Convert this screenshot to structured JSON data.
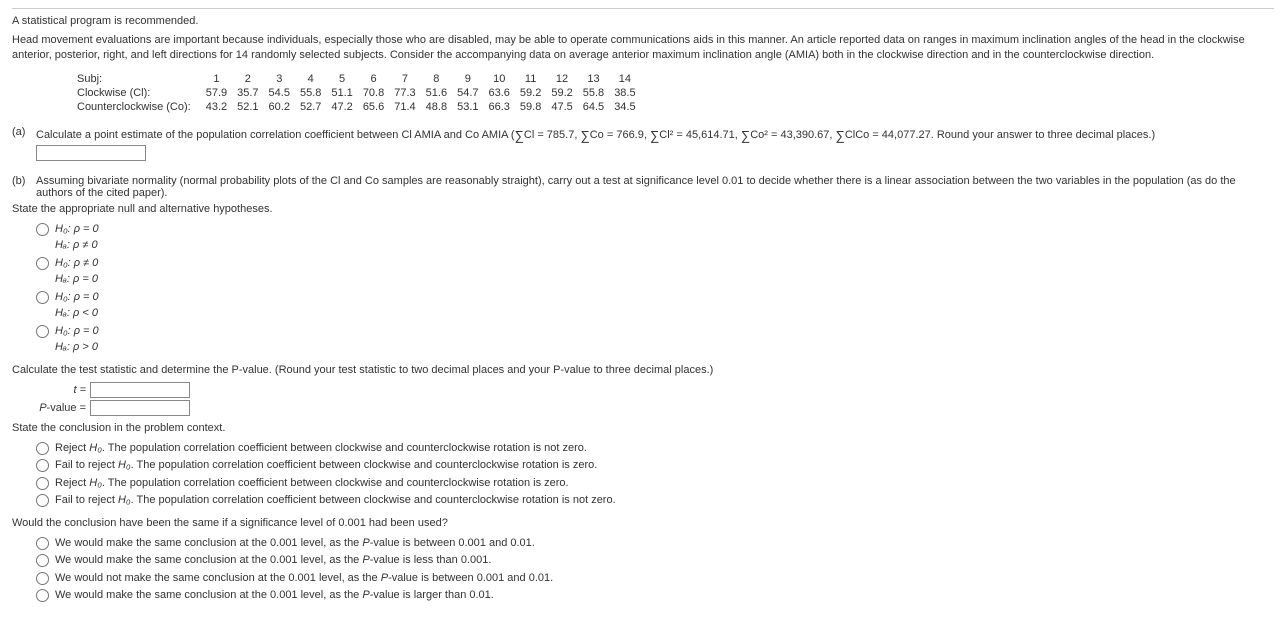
{
  "recommend": "A statistical program is recommended.",
  "intro": "Head movement evaluations are important because individuals, especially those who are disabled, may be able to operate communications aids in this manner. An article reported data on ranges in maximum inclination angles of the head in the clockwise anterior, posterior, right, and left directions for 14 randomly selected subjects. Consider the accompanying data on average anterior maximum inclination angle (AMIA) both in the clockwise direction and in the counterclockwise direction.",
  "table": {
    "labels": {
      "subj": "Subj:",
      "cl": "Clockwise (Cl):",
      "co": "Counterclockwise (Co):"
    },
    "cols": [
      "1",
      "2",
      "3",
      "4",
      "5",
      "6",
      "7",
      "8",
      "9",
      "10",
      "11",
      "12",
      "13",
      "14"
    ],
    "cl": [
      "57.9",
      "35.7",
      "54.5",
      "55.8",
      "51.1",
      "70.8",
      "77.3",
      "51.6",
      "54.7",
      "63.6",
      "59.2",
      "59.2",
      "55.8",
      "38.5"
    ],
    "co": [
      "43.2",
      "52.1",
      "60.2",
      "52.7",
      "47.2",
      "65.6",
      "71.4",
      "48.8",
      "53.1",
      "66.3",
      "59.8",
      "47.5",
      "64.5",
      "34.5"
    ]
  },
  "partA": {
    "label": "(a)",
    "text1": "Calculate a point estimate of the population correlation coefficient between Cl AMIA and Co AMIA",
    "sums": {
      "s1": "Cl = 785.7,",
      "s2": "Co = 766.9,",
      "s3": "Cl² = 45,614.71,",
      "s4": "Co² = 43,390.67,",
      "s5": "ClCo = 44,077.27."
    },
    "text2": "Round your answer to three decimal places.)"
  },
  "partB": {
    "label": "(b)",
    "intro": "Assuming bivariate normality (normal probability plots of the Cl and Co samples are reasonably straight), carry out a test at significance level 0.01 to decide whether there is a linear association between the two variables in the population (as do the authors of the cited paper).",
    "hypPrompt": "State the appropriate null and alternative hypotheses.",
    "hyp": {
      "o1a": "H₀: ρ = 0",
      "o1b": "Hₐ: ρ ≠ 0",
      "o2a": "H₀: ρ ≠ 0",
      "o2b": "Hₐ: ρ = 0",
      "o3a": "H₀: ρ = 0",
      "o3b": "Hₐ: ρ < 0",
      "o4a": "H₀: ρ = 0",
      "o4b": "Hₐ: ρ > 0"
    },
    "calcPrompt": "Calculate the test statistic and determine the P-value. (Round your test statistic to two decimal places and your P-value to three decimal places.)",
    "tlabel": "t =",
    "plabel": "P-value =",
    "concPrompt": "State the conclusion in the problem context.",
    "conc": {
      "c1a": "Reject ",
      "c1b": ". The population correlation coefficient between clockwise and counterclockwise rotation is not zero.",
      "c2a": "Fail to reject ",
      "c2b": ". The population correlation coefficient between clockwise and counterclockwise rotation is zero.",
      "c3a": "Reject ",
      "c3b": ". The population correlation coefficient between clockwise and counterclockwise rotation is zero.",
      "c4a": "Fail to reject ",
      "c4b": ". The population correlation coefficient between clockwise and counterclockwise rotation is not zero."
    },
    "h0": "H₀",
    "alphaPrompt": "Would the conclusion have been the same if a significance level of 0.001 had been used?",
    "alpha": {
      "a1": "We would make the same conclusion at the 0.001 level, as the P-value is between 0.001 and 0.01.",
      "a2": "We would make the same conclusion at the 0.001 level, as the P-value is less than 0.001.",
      "a3": "We would not make the same conclusion at the 0.001 level, as the P-value is between 0.001 and 0.01.",
      "a4": "We would make the same conclusion at the 0.001 level, as the P-value is larger than 0.01."
    }
  }
}
